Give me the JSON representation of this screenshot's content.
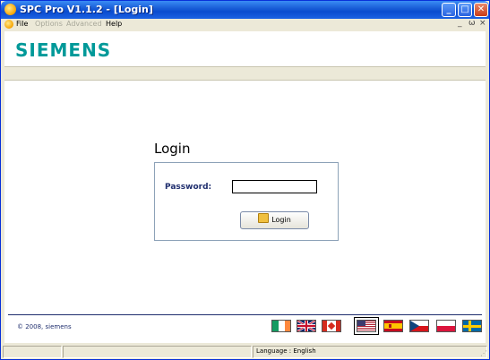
{
  "window": {
    "title": "SPC Pro V1.1.2 - [Login]"
  },
  "menubar": {
    "items": [
      {
        "label": "File",
        "enabled": true
      },
      {
        "label": "Options",
        "enabled": false
      },
      {
        "label": "Advanced",
        "enabled": false
      },
      {
        "label": "Help",
        "enabled": true
      }
    ],
    "mdi_min": "_",
    "mdi_restore": "ѡ",
    "mdi_close": "×"
  },
  "brand": {
    "logo_text": "SIEMENS",
    "color": "#009999"
  },
  "login": {
    "title": "Login",
    "password_label": "Password:",
    "password_value": "",
    "button_label": "Login"
  },
  "footer": {
    "copyright": "© 2008, siemens"
  },
  "languages": [
    {
      "name": "Irish",
      "selected": false
    },
    {
      "name": "English (UK)",
      "selected": false
    },
    {
      "name": "Canadian",
      "selected": false
    },
    {
      "name": "English (US)",
      "selected": true
    },
    {
      "name": "Spanish",
      "selected": false
    },
    {
      "name": "Czech",
      "selected": false
    },
    {
      "name": "Polish",
      "selected": false
    },
    {
      "name": "Swedish",
      "selected": false
    }
  ],
  "status": {
    "language": "Language : English"
  }
}
